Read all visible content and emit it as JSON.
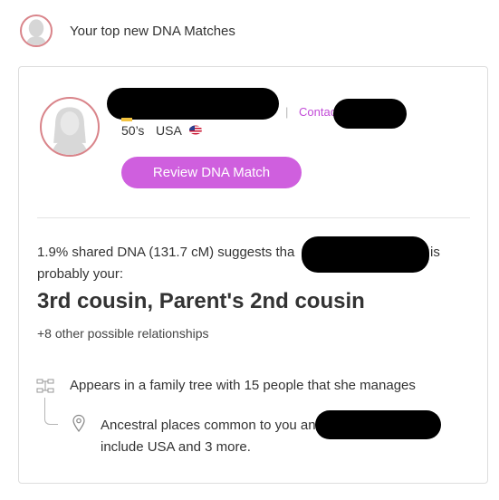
{
  "header": {
    "title": "Your top new DNA Matches"
  },
  "match": {
    "separator": "|",
    "contact_label": "Contac",
    "age": "50’s",
    "country": "USA",
    "review_button": "Review DNA Match"
  },
  "dna": {
    "shared_prefix": "1.9% shared DNA (131.7 cM) suggests tha",
    "shared_suffix": "is",
    "probably": "probably your:",
    "relationship": "3rd cousin, Parent's 2nd cousin",
    "other_relationships": "+8 other possible relationships"
  },
  "insights": {
    "tree_text": "Appears in a family tree with 15 people that she manages",
    "places_prefix": "Ancestral places common to you an",
    "places_include": "include ",
    "places_country": "USA",
    "places_and": " and ",
    "places_more": "3 more",
    "places_period": "."
  },
  "colors": {
    "accent": "#cf5fde",
    "link": "#c24bd8",
    "avatar_ring": "#d9848a"
  },
  "icons": [
    "person-silhouette-icon",
    "us-flag-icon",
    "family-tree-icon",
    "location-pin-icon"
  ]
}
